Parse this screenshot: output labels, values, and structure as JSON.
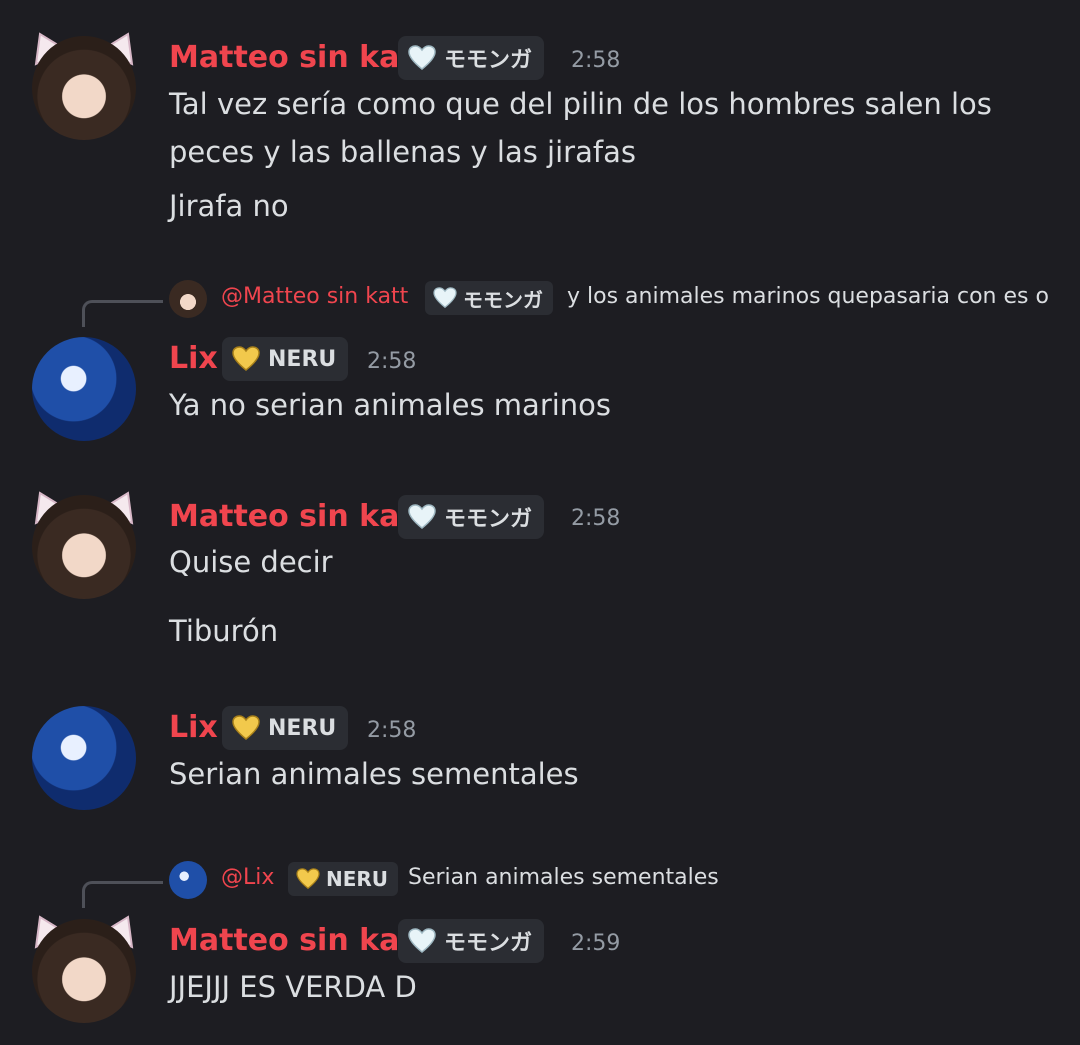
{
  "colors": {
    "background": "#1d1d22",
    "username": "#f0454e",
    "text": "#dbdee1",
    "timestamp": "#949ba4",
    "tag_background": "#2b2d33",
    "heart_white": "#e8f4f8",
    "heart_gold": "#f2c94c"
  },
  "messages": [
    {
      "author": "Matteo sin katt",
      "role_icon": "white-heart-icon",
      "role": "モモンガ",
      "time": "2:58",
      "lines": [
        "Tal vez sería como que del pilin de los hombres salen los",
        "peces y las ballenas y las jirafas",
        "Jirafa no"
      ]
    },
    {
      "reply": {
        "author": "@Matteo sin katt",
        "role_icon": "white-heart-icon",
        "role": "モモンガ",
        "text": "y los animales marinos quepasaria con es o"
      },
      "author": "Lix",
      "role_icon": "gold-heart-icon",
      "role": "NERU",
      "time": "2:58",
      "lines": [
        "Ya no serian animales marinos"
      ]
    },
    {
      "author": "Matteo sin katt",
      "role_icon": "white-heart-icon",
      "role": "モモンガ",
      "time": "2:58",
      "lines": [
        "Quise decir",
        "Tiburón"
      ]
    },
    {
      "author": "Lix",
      "role_icon": "gold-heart-icon",
      "role": "NERU",
      "time": "2:58",
      "lines": [
        "Serian animales sementales"
      ]
    },
    {
      "reply": {
        "author": "@Lix",
        "role_icon": "gold-heart-icon",
        "role": "NERU",
        "text": "Serian animales sementales"
      },
      "author": "Matteo sin katt",
      "role_icon": "white-heart-icon",
      "role": "モモンガ",
      "time": "2:59",
      "lines": [
        "JJEJJJ ES VERDA D"
      ]
    }
  ]
}
